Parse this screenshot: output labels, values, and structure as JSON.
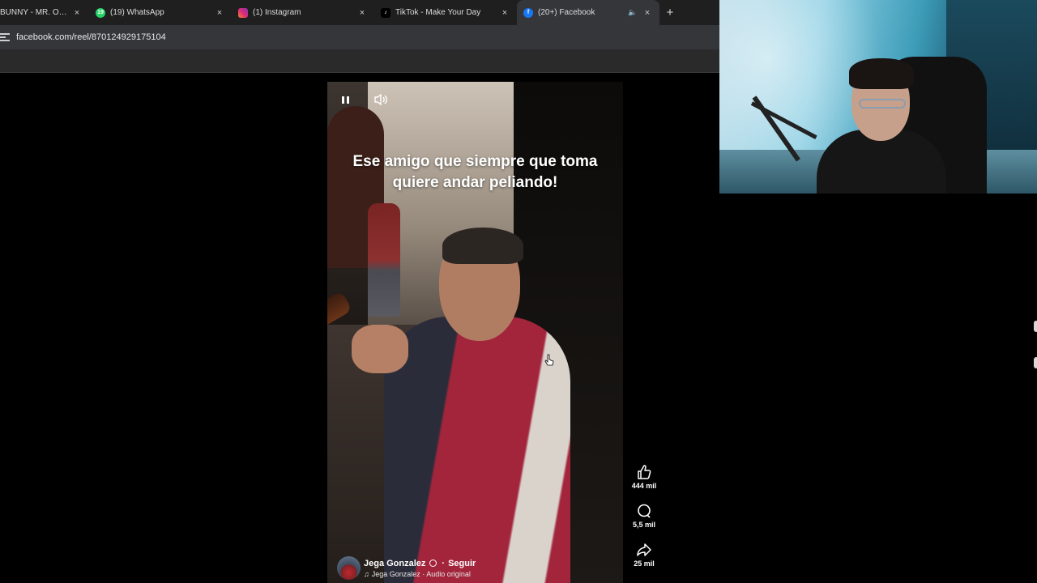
{
  "browser": {
    "tabs": [
      {
        "title": "BUNNY - MR. OCTO",
        "favicon": "music-icon",
        "active": false
      },
      {
        "title": "(19) WhatsApp",
        "favicon": "whatsapp-icon",
        "badge": "19",
        "active": false
      },
      {
        "title": "(1) Instagram",
        "favicon": "instagram-icon",
        "active": false
      },
      {
        "title": "TikTok - Make Your Day",
        "favicon": "tiktok-icon",
        "active": false
      },
      {
        "title": "(20+) Facebook",
        "favicon": "facebook-icon",
        "active": true
      }
    ],
    "new_tab_label": "+",
    "close_glyph": "×",
    "url": "facebook.com/reel/870124929175104"
  },
  "reel": {
    "caption_line1": "Ese amigo que siempre que toma",
    "caption_line2": "quiere andar peliando!",
    "author_name": "Jega Gonzalez",
    "follow_label": "Seguir",
    "audio_text": "Jega Gonzalez · Audio original",
    "likes": "444 mil",
    "comments": "5,5 mil",
    "shares": "25 mil"
  },
  "colors": {
    "facebook_blue": "#1877f2",
    "whatsapp_green": "#25d366",
    "instagram_pink": "#e1306c",
    "jacket_red": "#a3253c"
  }
}
